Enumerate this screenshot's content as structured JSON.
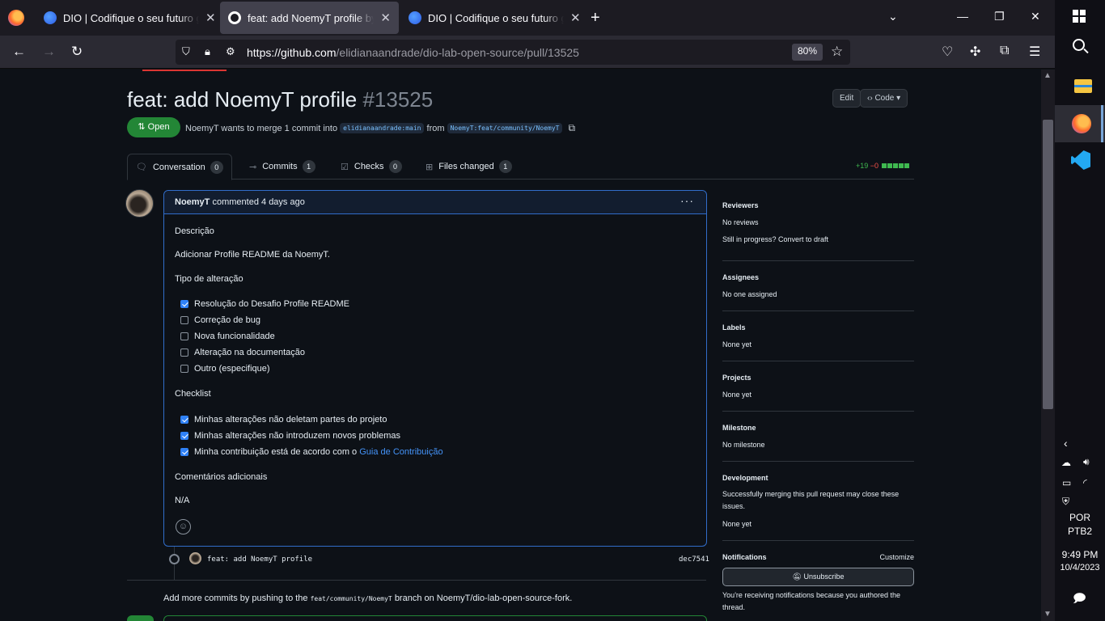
{
  "browser": {
    "tabs": [
      {
        "title": "DIO | Codifique o seu futuro global",
        "active": false,
        "icon": "dio-icon"
      },
      {
        "title": "feat: add NoemyT profile by NoemyT",
        "active": true,
        "icon": "github-icon"
      },
      {
        "title": "DIO | Codifique o seu futuro global",
        "active": false,
        "icon": "dio-icon"
      }
    ],
    "new_tab": "+",
    "tab_list": "⌄",
    "url_host": "https://github.com",
    "url_path": "/elidianaandrade/dio-lab-open-source/pull/13525",
    "zoom": "80%"
  },
  "pr": {
    "title": "feat: add NoemyT profile",
    "number": "#13525",
    "edit_label": "Edit",
    "code_label": "Code",
    "state": "Open",
    "meta_prefix": "NoemyT wants to merge 1 commit into",
    "base_branch": "elidianaandrade:main",
    "meta_from": "from",
    "head_branch": "NoemyT:feat/community/NoemyT",
    "tabs": [
      {
        "label": "Conversation",
        "count": "0"
      },
      {
        "label": "Commits",
        "count": "1"
      },
      {
        "label": "Checks",
        "count": "0"
      },
      {
        "label": "Files changed",
        "count": "1"
      }
    ],
    "additions": "+19",
    "deletions": "−0"
  },
  "comment": {
    "author": "NoemyT",
    "action": "commented",
    "time": "4 days ago",
    "heading_description": "Descrição",
    "description": "Adicionar Profile README da NoemyT.",
    "heading_change_type": "Tipo de alteração",
    "change_types": [
      {
        "label": "Resolução do Desafio Profile README",
        "checked": true
      },
      {
        "label": "Correção de bug",
        "checked": false
      },
      {
        "label": "Nova funcionalidade",
        "checked": false
      },
      {
        "label": "Alteração na documentação",
        "checked": false
      },
      {
        "label": "Outro (especifique)",
        "checked": false
      }
    ],
    "heading_checklist": "Checklist",
    "checklist": [
      {
        "label": "Minhas alterações não deletam partes do projeto",
        "checked": true
      },
      {
        "label": "Minhas alterações não introduzem novos problemas",
        "checked": true
      },
      {
        "label": "Minha contribuição está de acordo com o",
        "link": "Guia de Contribuição",
        "checked": true
      }
    ],
    "heading_comments": "Comentários adicionais",
    "comments_value": "N/A"
  },
  "commit": {
    "message": "feat: add NoemyT profile",
    "sha": "dec7541"
  },
  "footer": {
    "text_before": "Add more commits by pushing to the",
    "branch": "feat/community/NoemyT",
    "text_after": "branch on NoemyT/dio-lab-open-source-fork."
  },
  "sidebar": {
    "reviewers_title": "Reviewers",
    "reviewers_value": "No reviews",
    "draft_text": "Still in progress? Convert to draft",
    "assignees_title": "Assignees",
    "assignees_value": "No one assigned",
    "labels_title": "Labels",
    "labels_value": "None yet",
    "projects_title": "Projects",
    "projects_value": "None yet",
    "milestone_title": "Milestone",
    "milestone_value": "No milestone",
    "development_title": "Development",
    "development_desc": "Successfully merging this pull request may close these issues.",
    "development_value": "None yet",
    "notifications_title": "Notifications",
    "customize": "Customize",
    "unsubscribe": "Unsubscribe",
    "notif_reason": "You're receiving notifications because you authored the thread."
  },
  "taskbar": {
    "lang1": "POR",
    "lang2": "PTB2",
    "time": "9:49 PM",
    "date": "10/4/2023"
  },
  "colors": {
    "accent_blue": "#316dca",
    "open_green": "#238636",
    "page_bg": "#0d1117"
  }
}
